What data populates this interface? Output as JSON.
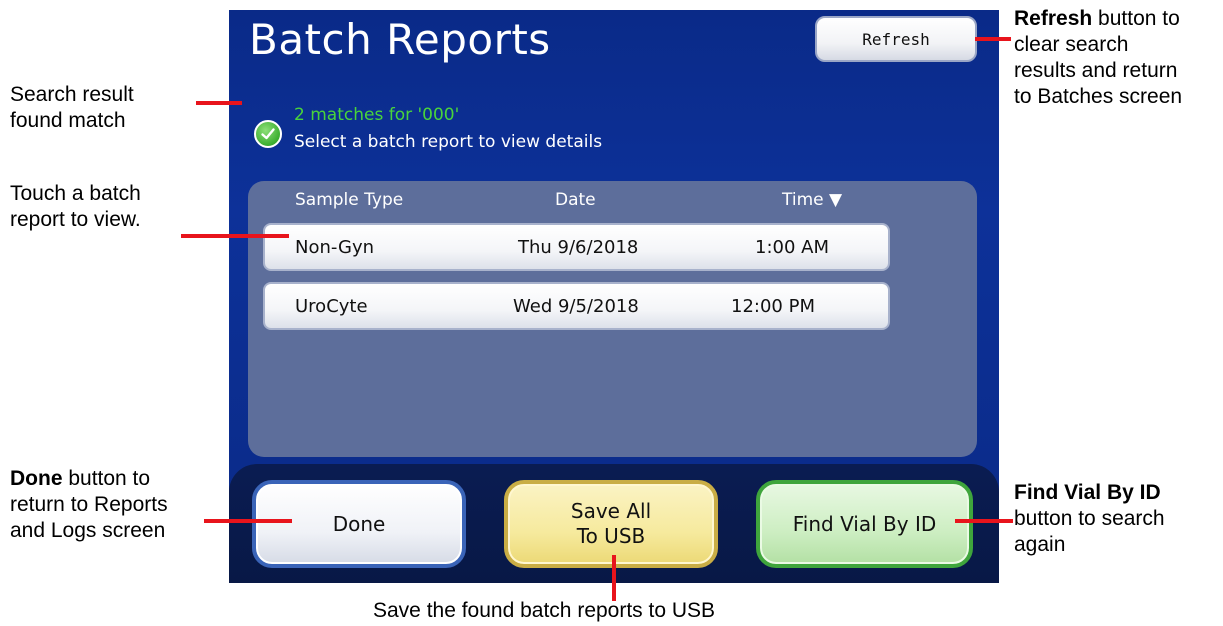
{
  "screen": {
    "title": "Batch Reports",
    "refresh_label": "Refresh",
    "status": {
      "match_text": "2 matches for '000'",
      "hint_text": "Select a batch report to view details",
      "icon": "check-circle-icon"
    },
    "table": {
      "columns": [
        "Sample Type",
        "Date",
        "Time ▼"
      ],
      "rows": [
        {
          "sample_type": "Non-Gyn",
          "date": "Thu 9/6/2018",
          "time": "1:00 AM"
        },
        {
          "sample_type": "UroCyte",
          "date": "Wed 9/5/2018",
          "time": "12:00 PM"
        }
      ]
    },
    "buttons": {
      "done": "Done",
      "save_line1": "Save All",
      "save_line2": "To USB",
      "find": "Find Vial By ID"
    }
  },
  "callouts": {
    "search_result": {
      "line1": "Search result",
      "line2": "found match"
    },
    "touch_row": {
      "line1": "Touch a batch",
      "line2": "report to view."
    },
    "done": {
      "bold": "Done",
      "line1_rest": " button to",
      "line2": "return to Reports",
      "line3": "and Logs screen"
    },
    "refresh": {
      "bold": "Refresh",
      "line1_rest": " button to",
      "line2": "clear search",
      "line3": "results and return",
      "line4": "to Batches screen"
    },
    "find": {
      "bold": "Find Vial By ID",
      "line2": "button to search",
      "line3": "again"
    },
    "save": {
      "text": "Save the found batch reports to USB"
    }
  },
  "colors": {
    "screen_bg": "#0d3199",
    "panel_bg": "#5d6e9b",
    "match_green": "#49d43b",
    "leader_red": "#e8141c"
  }
}
